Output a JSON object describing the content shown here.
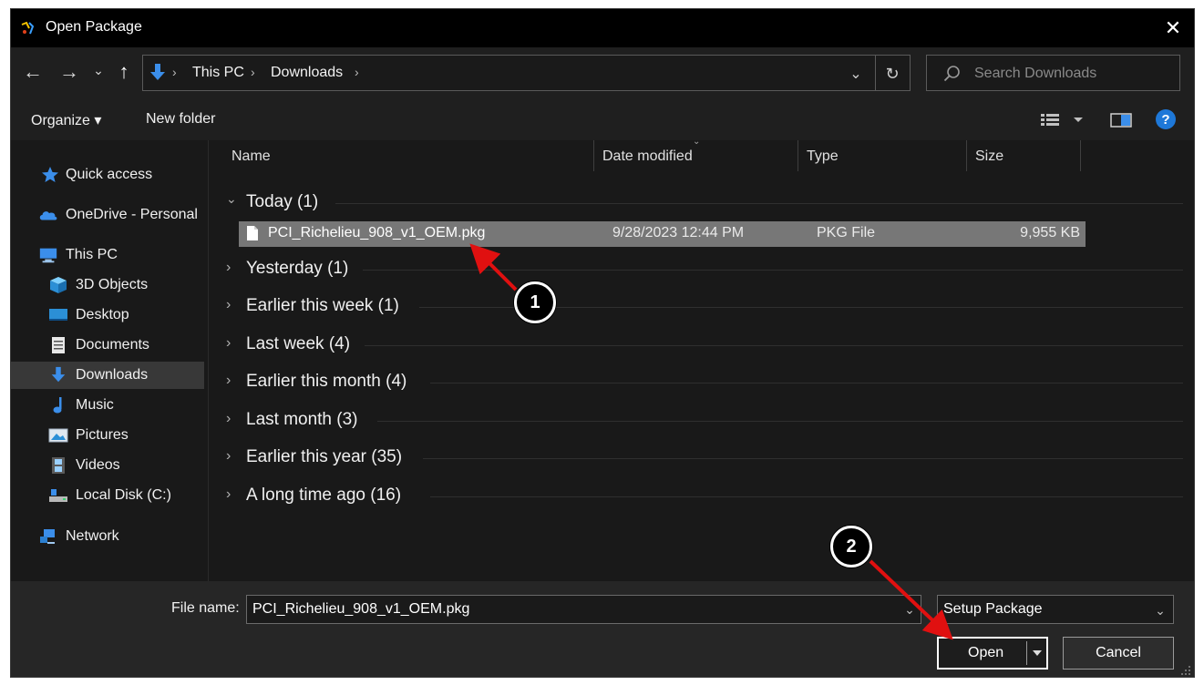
{
  "window": {
    "title": "Open Package",
    "close_glyph": "✕"
  },
  "nav": {
    "back_glyph": "←",
    "forward_glyph": "→",
    "recent_glyph": "⌄",
    "up_glyph": "↑",
    "breadcrumbs": [
      "This PC",
      "Downloads"
    ],
    "separator": "›",
    "dropdown_glyph": "⌄",
    "refresh_glyph": "↻"
  },
  "search": {
    "placeholder": "Search Downloads"
  },
  "toolbar": {
    "organize_label": "Organize ▾",
    "new_folder_label": "New folder",
    "help_glyph": "?"
  },
  "sidebar": {
    "items": [
      {
        "label": "Quick access",
        "icon": "star-icon"
      },
      {
        "label": "OneDrive - Personal",
        "icon": "cloud-icon"
      },
      {
        "label": "This PC",
        "icon": "computer-icon"
      },
      {
        "label": "3D Objects",
        "icon": "cube-icon"
      },
      {
        "label": "Desktop",
        "icon": "desktop-icon"
      },
      {
        "label": "Documents",
        "icon": "document-icon"
      },
      {
        "label": "Downloads",
        "icon": "download-arrow-icon",
        "selected": true
      },
      {
        "label": "Music",
        "icon": "music-note-icon"
      },
      {
        "label": "Pictures",
        "icon": "picture-icon"
      },
      {
        "label": "Videos",
        "icon": "film-icon"
      },
      {
        "label": "Local Disk (C:)",
        "icon": "drive-icon"
      },
      {
        "label": "Network",
        "icon": "network-icon"
      }
    ]
  },
  "columns": {
    "name": "Name",
    "date": "Date modified",
    "type": "Type",
    "size": "Size",
    "sort_glyph": "⌄"
  },
  "groups": [
    {
      "label": "Today (1)",
      "expanded": true
    },
    {
      "label": "Yesterday (1)"
    },
    {
      "label": "Earlier this week (1)"
    },
    {
      "label": "Last week (4)"
    },
    {
      "label": "Earlier this month (4)"
    },
    {
      "label": "Last month (3)"
    },
    {
      "label": "Earlier this year (35)"
    },
    {
      "label": "A long time ago (16)"
    }
  ],
  "chevrons": {
    "expanded": "⌄",
    "collapsed": "›"
  },
  "file": {
    "name": "PCI_Richelieu_908_v1_OEM.pkg",
    "date": "9/28/2023 12:44 PM",
    "type": "PKG File",
    "size": "9,955 KB"
  },
  "bottom": {
    "file_name_label": "File name:",
    "file_name_value": "PCI_Richelieu_908_v1_OEM.pkg",
    "file_type_value": "Setup Package",
    "open_label": "Open",
    "cancel_label": "Cancel"
  },
  "annotations": {
    "callout_1": "1",
    "callout_2": "2",
    "arrow_color": "#e01010"
  },
  "colors": {
    "accent": "#1e90ff",
    "selected_row": "#777777",
    "dialog_bg": "#191919"
  }
}
